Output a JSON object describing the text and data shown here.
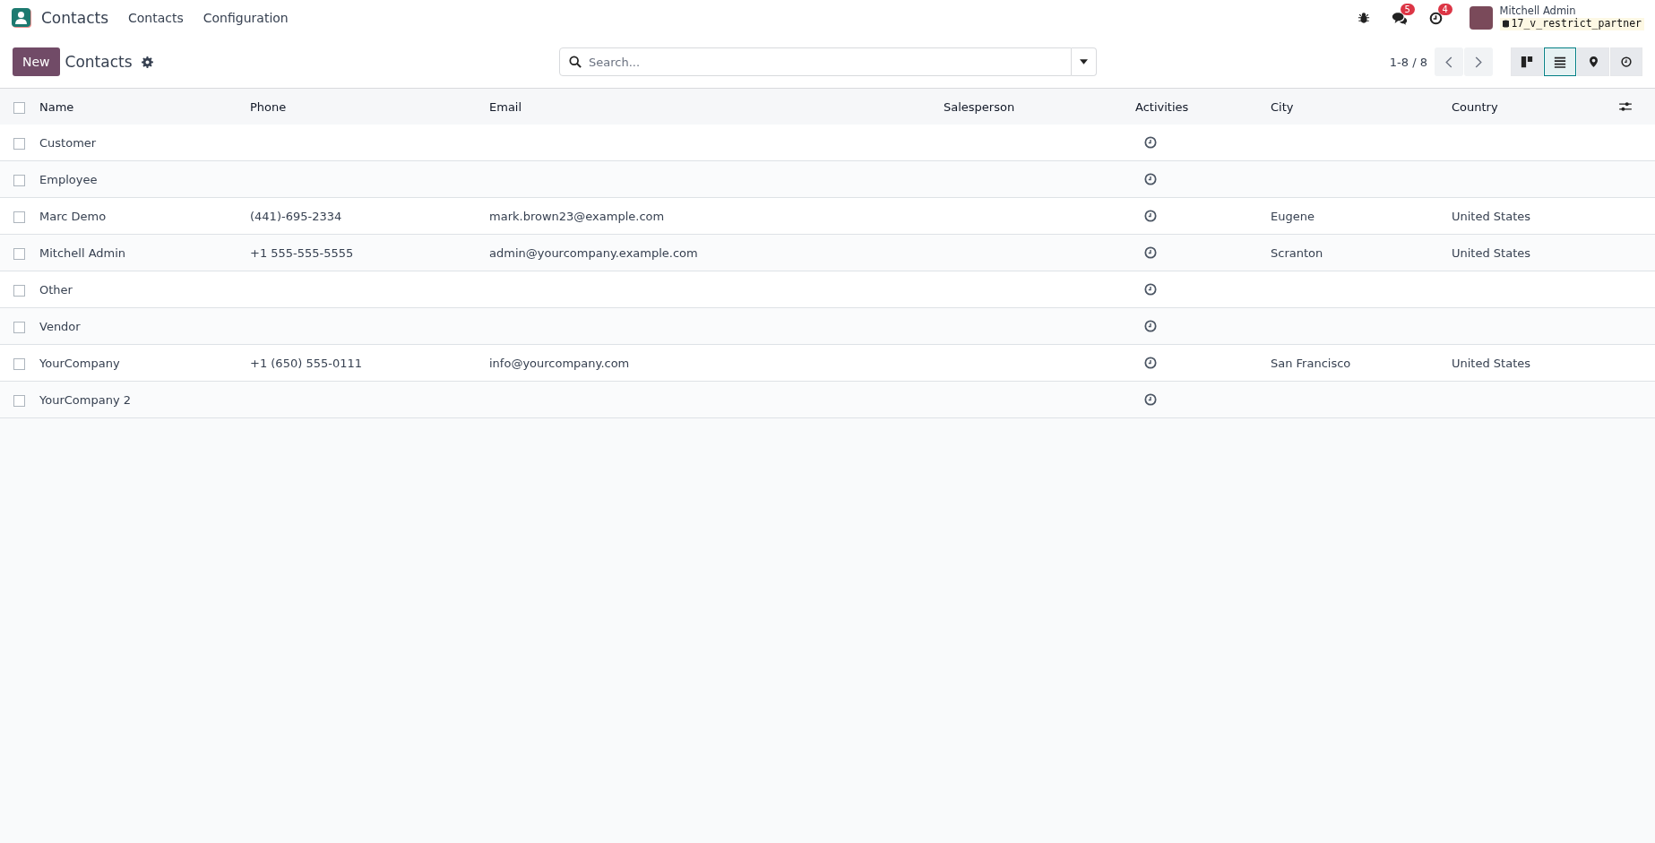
{
  "navbar": {
    "app_name": "Contacts",
    "menu": [
      "Contacts",
      "Configuration"
    ],
    "messages_count": "5",
    "activities_count": "4",
    "user_name": "Mitchell Admin",
    "database": "17_v_restrict_partner"
  },
  "control_panel": {
    "new_button": "New",
    "breadcrumb": "Contacts",
    "search": {
      "placeholder": "Search..."
    },
    "pager": "1-8 / 8",
    "views": [
      {
        "kind": "kanban",
        "selected": false
      },
      {
        "kind": "list",
        "selected": true
      },
      {
        "kind": "map",
        "selected": false
      },
      {
        "kind": "activity",
        "selected": false
      }
    ]
  },
  "table": {
    "select_all_checked": false,
    "columns": [
      "Name",
      "Phone",
      "Email",
      "Salesperson",
      "Activities",
      "City",
      "Country"
    ],
    "rows": [
      {
        "checked": false,
        "name": "Customer",
        "phone": "",
        "email": "",
        "city": "",
        "country": ""
      },
      {
        "checked": false,
        "name": "Employee",
        "phone": "",
        "email": "",
        "city": "",
        "country": ""
      },
      {
        "checked": false,
        "name": "Marc Demo",
        "phone": "(441)-695-2334",
        "email": "mark.brown23@example.com",
        "city": "Eugene",
        "country": "United States"
      },
      {
        "checked": false,
        "name": "Mitchell Admin",
        "phone": "+1 555-555-5555",
        "email": "admin@yourcompany.example.com",
        "city": "Scranton",
        "country": "United States"
      },
      {
        "checked": false,
        "name": "Other",
        "phone": "",
        "email": "",
        "city": "",
        "country": ""
      },
      {
        "checked": false,
        "name": "Vendor",
        "phone": "",
        "email": "",
        "city": "",
        "country": ""
      },
      {
        "checked": false,
        "name": "YourCompany",
        "phone": "+1 (650) 555-0111",
        "email": "info@yourcompany.com",
        "city": "San Francisco",
        "country": "United States"
      },
      {
        "checked": false,
        "name": "YourCompany 2",
        "phone": "",
        "email": "",
        "city": "",
        "country": ""
      }
    ]
  }
}
